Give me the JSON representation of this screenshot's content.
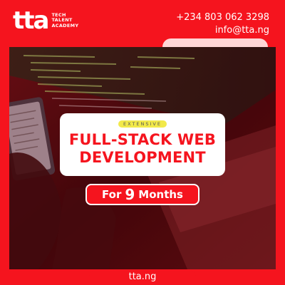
{
  "brand": {
    "logo_mark": "tta",
    "line1": "TECH",
    "line2": "TALENT",
    "line3": "ACADEMY"
  },
  "contact": {
    "phone": "+234 803 062 3298",
    "email": "info@tta.ng"
  },
  "course": {
    "tag": "EXTENSIVE",
    "title_line1": "FULL-STACK WEB",
    "title_line2": "DEVELOPMENT"
  },
  "duration": {
    "prefix": "For",
    "number": "9",
    "unit": "Months"
  },
  "footer": {
    "website": "tta.ng"
  },
  "colors": {
    "brand_red": "#f5141e",
    "tag_yellow": "#f2e94a",
    "text_white": "#ffffff"
  }
}
